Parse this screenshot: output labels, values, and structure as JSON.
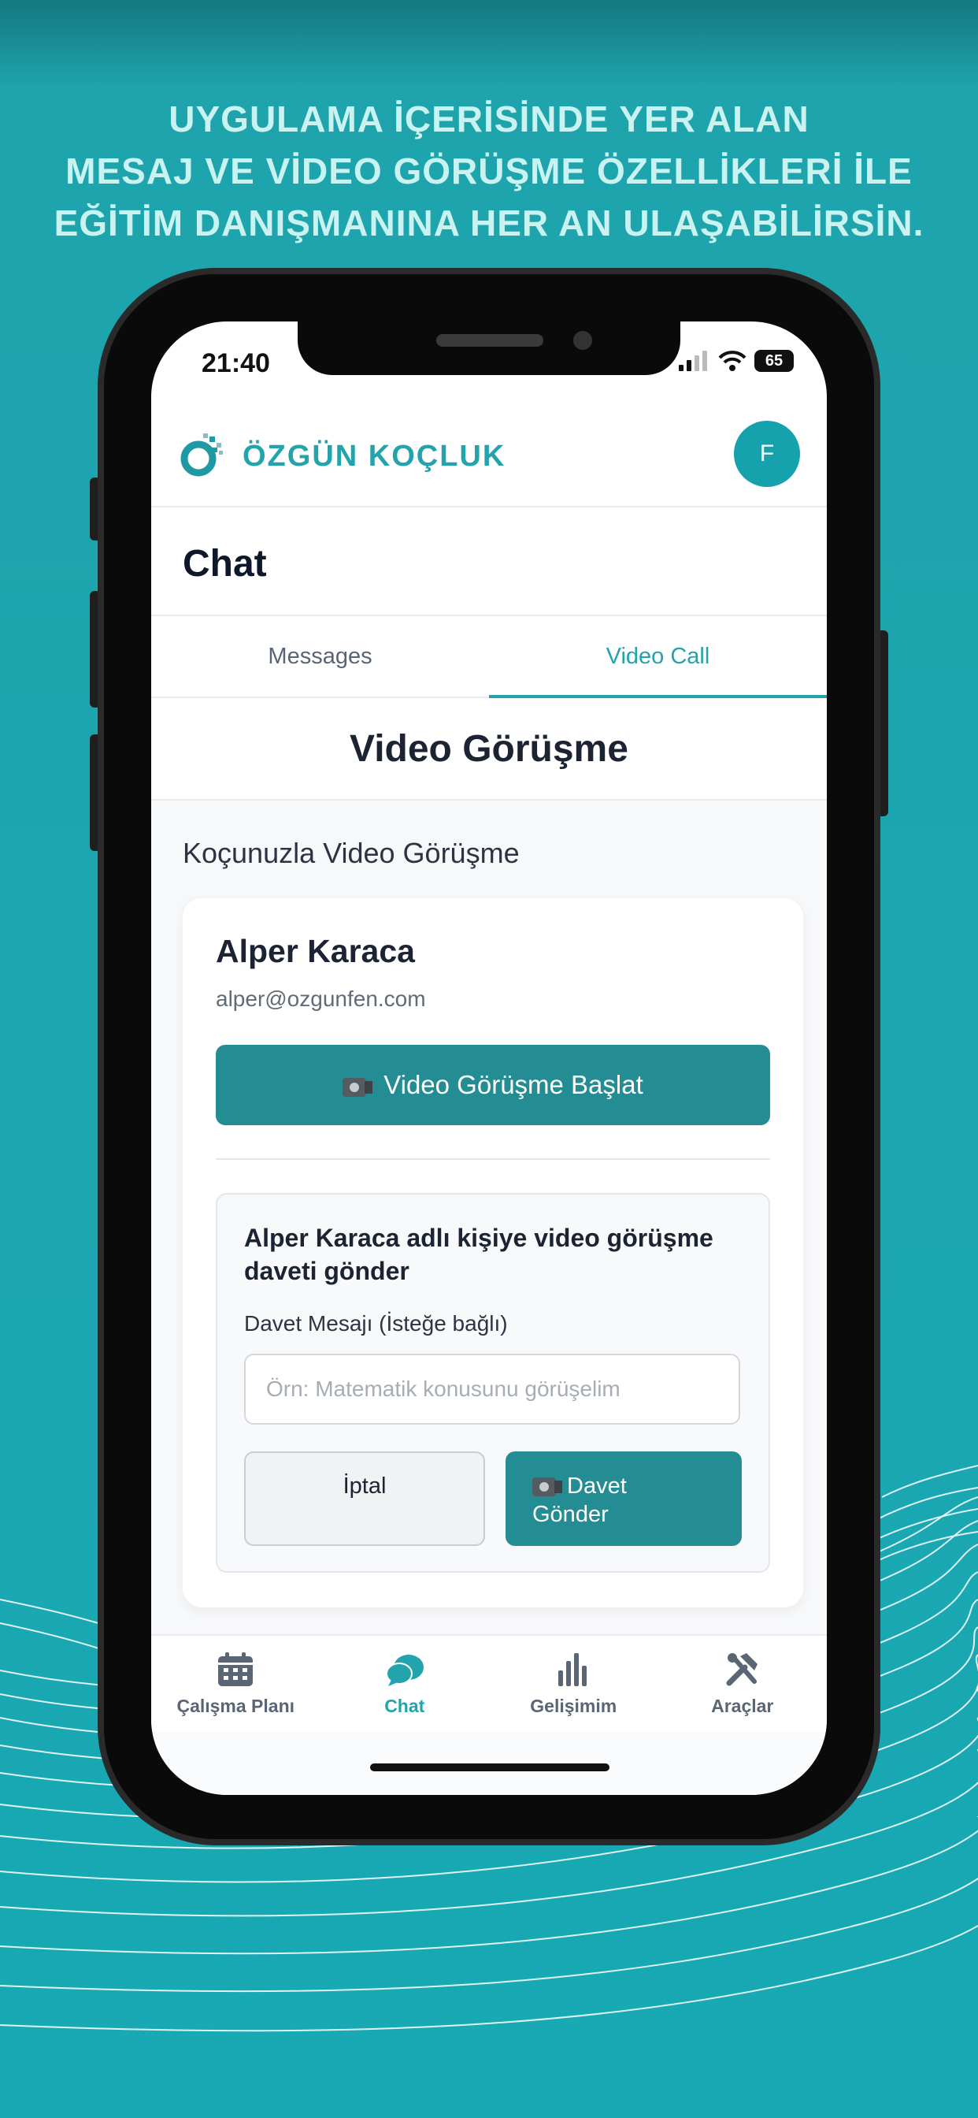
{
  "promo": {
    "line1": "UYGULAMA İÇERİSİNDE YER ALAN",
    "line2": "MESAJ VE VİDEO GÖRÜŞME ÖZELLİKLERİ İLE",
    "line3": "EĞİTİM DANIŞMANINA HER AN ULAŞABİLİRSİN."
  },
  "status_bar": {
    "time": "21:40",
    "battery": "65"
  },
  "header": {
    "brand": "ÖZGÜN KOÇLUK",
    "avatar_initial": "F"
  },
  "page": {
    "title": "Chat"
  },
  "tabs": [
    {
      "label": "Messages",
      "active": false
    },
    {
      "label": "Video Call",
      "active": true
    }
  ],
  "video": {
    "section_title": "Video Görüşme",
    "subtitle": "Koçunuzla Video Görüşme",
    "coach": {
      "name": "Alper Karaca",
      "email": "alper@ozgunfen.com"
    },
    "start_button": "Video Görüşme Başlat",
    "invite": {
      "title": "Alper Karaca adlı kişiye video görüşme daveti gönder",
      "label": "Davet Mesajı (İsteğe bağlı)",
      "placeholder": "Örn: Matematik konusunu görüşelim",
      "cancel_button": "İptal",
      "send_line1": "Davet",
      "send_line2": "Gönder"
    }
  },
  "bottom_nav": [
    {
      "label": "Çalışma Planı",
      "icon": "calendar-icon",
      "active": false
    },
    {
      "label": "Chat",
      "icon": "chat-bubbles-icon",
      "active": true
    },
    {
      "label": "Gelişimim",
      "icon": "bar-chart-icon",
      "active": false
    },
    {
      "label": "Araçlar",
      "icon": "tools-icon",
      "active": false
    }
  ],
  "colors": {
    "background": "#1ca6b0",
    "accent": "#23a3ac",
    "button": "#248d93",
    "headline": "#c8f3f1"
  }
}
